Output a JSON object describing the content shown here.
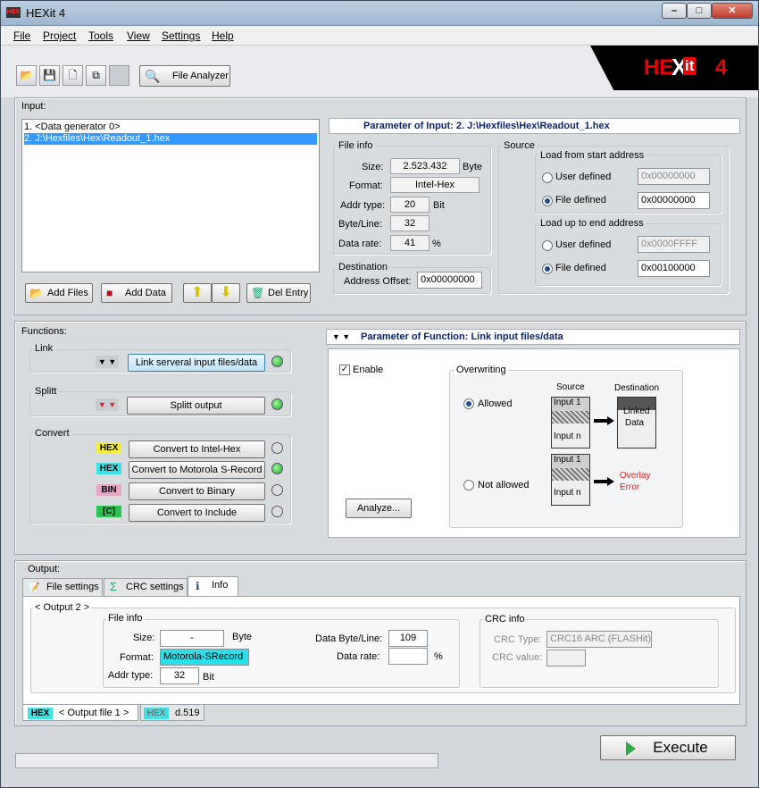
{
  "window": {
    "title": "HEXit 4",
    "minimize": "–",
    "maximize": "□",
    "close": "✕"
  },
  "menu": [
    "File",
    "Project",
    "Tools",
    "View",
    "Settings",
    "Help"
  ],
  "toolbar": {
    "file_analyzer": "File Analyzer"
  },
  "logo": {
    "part1": "HE",
    "part2": "it",
    "part3": "4"
  },
  "input": {
    "label": "Input:",
    "items": [
      "1.  <Data generator 0>",
      "2.  J:\\Hexfiles\\Hex\\Readout_1.hex"
    ],
    "buttons": {
      "add_files": "Add Files",
      "add_data": "Add Data",
      "del_entry": "Del Entry"
    }
  },
  "param_input": {
    "title": "Parameter of Input: 2.  J:\\Hexfiles\\Hex\\Readout_1.hex",
    "file_info": {
      "title": "File info",
      "size_label": "Size:",
      "size": "2.523.432",
      "size_unit": "Byte",
      "format_label": "Format:",
      "format": "Intel-Hex",
      "addr_label": "Addr type:",
      "addr": "20",
      "addr_unit": "Bit",
      "bpl_label": "Byte/Line:",
      "bpl": "32",
      "rate_label": "Data rate:",
      "rate": "41",
      "rate_unit": "%"
    },
    "destination": {
      "title": "Destination",
      "offset_label": "Address Offset:",
      "offset": "0x00000000"
    },
    "source": {
      "title": "Source",
      "start_title": "Load from start address",
      "user_defined": "User defined",
      "start_user": "0x00000000",
      "file_defined": "File defined",
      "start_file": "0x00000000",
      "end_title": "Load up to end address",
      "end_user": "0x0000FFFF",
      "end_file": "0x00100000"
    }
  },
  "functions": {
    "label": "Functions:",
    "link": {
      "title": "Link",
      "button": "Link serveral input files/data"
    },
    "split": {
      "title": "Splitt",
      "button": "Splitt output"
    },
    "convert": {
      "title": "Convert",
      "items": [
        {
          "tag": "HEX",
          "label": "Convert to Intel-Hex"
        },
        {
          "tag": "HEX",
          "label": "Convert to Motorola S-Record"
        },
        {
          "tag": "BIN",
          "label": "Convert to Binary"
        },
        {
          "tag": "[C]",
          "label": "Convert to Include"
        }
      ]
    }
  },
  "param_function": {
    "title": "Parameter of Function: Link input files/data",
    "enable": "Enable",
    "overwriting": "Overwriting",
    "allowed": "Allowed",
    "not_allowed": "Not allowed",
    "source": "Source",
    "destination": "Destination",
    "input1": "Input 1",
    "inputn": "Input n",
    "linked": "Linked",
    "data": "Data",
    "overlay": "Overlay",
    "error": "Error",
    "analyze": "Analyze..."
  },
  "output": {
    "label": "Output:",
    "tabs": [
      "File settings",
      "CRC settings",
      "Info"
    ],
    "nav": "< Output 2 >",
    "file_info": {
      "title": "File info",
      "size_label": "Size:",
      "size": "-",
      "size_unit": "Byte",
      "format_label": "Format:",
      "format": "Motorola-SRecord",
      "addr_label": "Addr type:",
      "addr": "32",
      "addr_unit": "Bit",
      "dbl_label": "Data Byte/Line:",
      "dbl": "109",
      "rate_label": "Data rate:",
      "rate": "",
      "rate_unit": "%"
    },
    "crc": {
      "title": "CRC info",
      "type_label": "CRC Type:",
      "type": "CRC16 ARC (FLASHit)",
      "value_label": "CRC value:",
      "value": ""
    },
    "bottom_tabs": [
      {
        "tag": "HEX",
        "label": "< Output file 1 >"
      },
      {
        "tag": "HEX",
        "label": "d.519"
      }
    ]
  },
  "execute": "Execute",
  "colors": {
    "hex_yellow": "#f5ef3a",
    "hex_cyan": "#3fe0e6",
    "bin_pink": "#e6a7c6",
    "c_green": "#2dc14f",
    "format_cyan": "#27e0ea",
    "logo_red": "#e00000",
    "header_blue": "#0a246a"
  }
}
